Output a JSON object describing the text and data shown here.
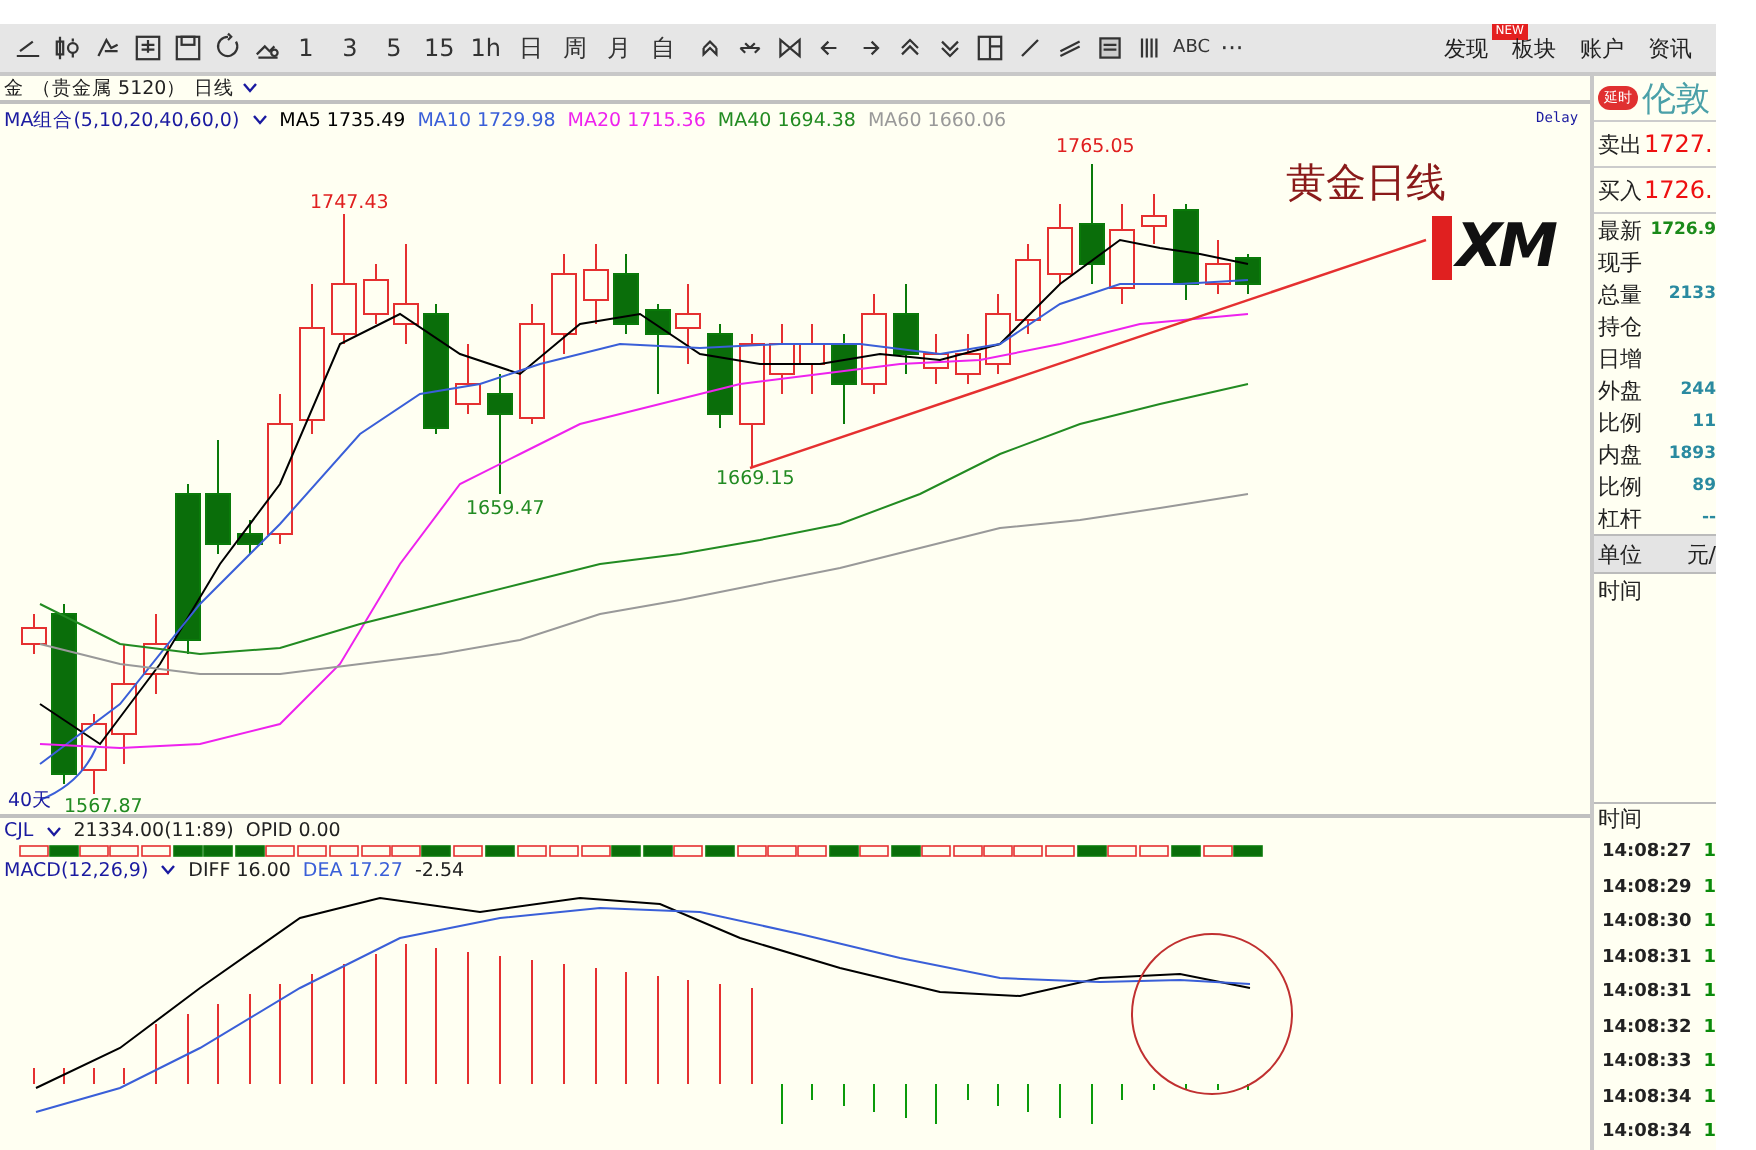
{
  "toolbar": {
    "periods": [
      "1",
      "3",
      "5",
      "15",
      "1h",
      "日",
      "周",
      "月",
      "自"
    ],
    "text_tool": "ABC",
    "more": "···",
    "links": [
      {
        "label": "发现",
        "badge": "NEW"
      },
      {
        "label": "板块"
      },
      {
        "label": "账户"
      },
      {
        "label": "资讯"
      }
    ]
  },
  "chart_header": {
    "symbol": "金",
    "group": "（贵金属 5120）",
    "period": "日线"
  },
  "ma_legend": {
    "group": "MA组合(5,10,20,40,60,0)",
    "items": [
      {
        "label": "MA5 1735.49",
        "color": "#000000"
      },
      {
        "label": "MA10 1729.98",
        "color": "#3a5fd8"
      },
      {
        "label": "MA20 1715.36",
        "color": "#ee22ee"
      },
      {
        "label": "MA40 1694.38",
        "color": "#228b22"
      },
      {
        "label": "MA60 1660.06",
        "color": "#999999"
      }
    ],
    "delay": "Delay"
  },
  "price_chart": {
    "labels": [
      {
        "text": "1747.43",
        "kind": "high"
      },
      {
        "text": "1659.47",
        "kind": "low"
      },
      {
        "text": "1669.15",
        "kind": "low"
      },
      {
        "text": "1765.05",
        "kind": "high"
      },
      {
        "text": "1567.87",
        "kind": "low"
      }
    ],
    "period_marker": "40天",
    "caption": "黄金日线",
    "logo": "XM"
  },
  "volume": {
    "label": "CJL",
    "reading": "21334.00(11:89)",
    "opid": "OPID 0.00"
  },
  "macd": {
    "label": "MACD(12,26,9)",
    "diff": "DIFF 16.00",
    "dea": "DEA 17.27",
    "macd": "-2.54"
  },
  "quote_panel": {
    "badge": "延时",
    "title": "伦敦",
    "sell": {
      "label": "卖出",
      "value": "1727."
    },
    "buy": {
      "label": "买入",
      "value": "1726."
    },
    "rows": [
      {
        "label": "最新",
        "value": "1726.9",
        "color": "#1a8a1a"
      },
      {
        "label": "现手",
        "value": null,
        "color": null
      },
      {
        "label": "总量",
        "value": "2133",
        "color": "#2a8aa0"
      },
      {
        "label": "持仓",
        "value": null,
        "color": null
      },
      {
        "label": "日增",
        "value": null,
        "color": null
      },
      {
        "label": "外盘",
        "value": "244",
        "color": "#2a8aa0"
      },
      {
        "label": "比例",
        "value": "11",
        "color": "#2a8aa0"
      },
      {
        "label": "内盘",
        "value": "1893",
        "color": "#2a8aa0"
      },
      {
        "label": "比例",
        "value": "89",
        "color": "#2a8aa0"
      },
      {
        "label": "杠杆",
        "value": "--",
        "color": "#2a8aa0"
      }
    ],
    "unit": {
      "label": "单位",
      "value": "元/"
    },
    "time_label": "时间",
    "ticks_header": "时间",
    "ticks": [
      {
        "time": "14:08:27",
        "volume": "1"
      },
      {
        "time": "14:08:29",
        "volume": "1"
      },
      {
        "time": "14:08:30",
        "volume": "1"
      },
      {
        "time": "14:08:31",
        "volume": "1"
      },
      {
        "time": "14:08:31",
        "volume": "1"
      },
      {
        "time": "14:08:32",
        "volume": "1"
      },
      {
        "time": "14:08:33",
        "volume": "1"
      },
      {
        "time": "14:08:34",
        "volume": "1"
      },
      {
        "time": "14:08:34",
        "volume": "1"
      }
    ]
  }
}
